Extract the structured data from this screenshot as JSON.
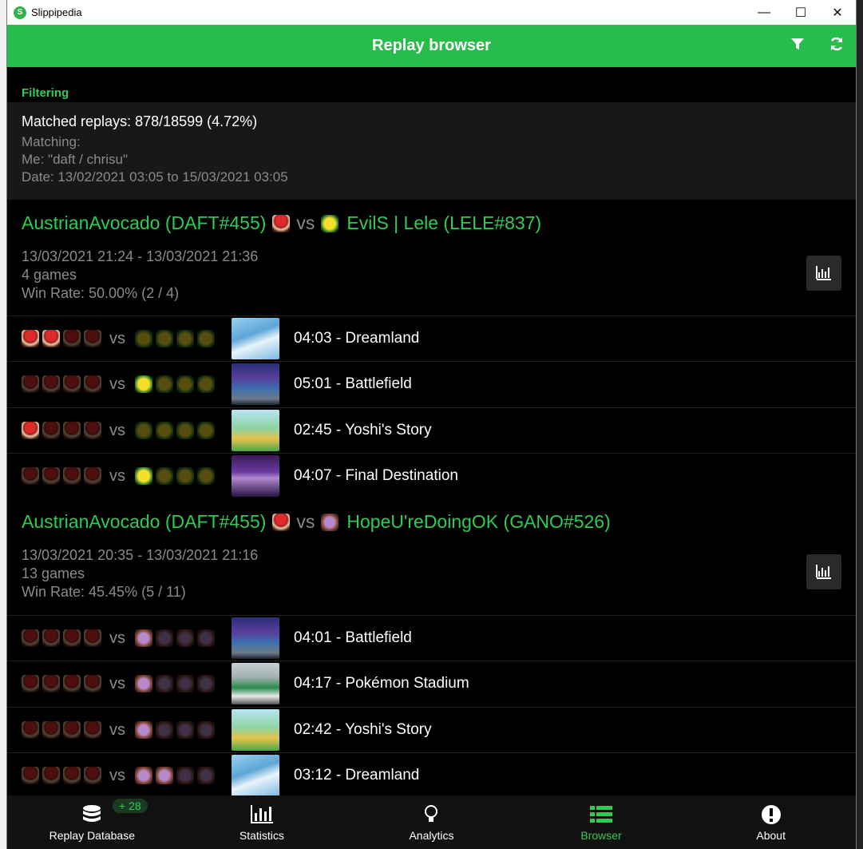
{
  "window": {
    "title": "Slippipedia",
    "minimize": "—",
    "maximize": "☐",
    "close": "✕"
  },
  "appbar": {
    "title": "Replay browser",
    "filter_icon": "filter-icon",
    "refresh_icon": "refresh-icon"
  },
  "filter": {
    "label": "Filtering",
    "matched": "Matched replays: 878/18599 (4.72%)",
    "matching": "Matching:",
    "me": "Me: \"daft / chrisu\"",
    "date": "Date: 13/02/2021 03:05 to 15/03/2021 03:05"
  },
  "groups": [
    {
      "player1": "AustrianAvocado (DAFT#455)",
      "vs": "vs",
      "player2": "EvilS | Lele (LELE#837)",
      "dates": "13/03/2021 21:24 - 13/03/2021 21:36",
      "games": "4 games",
      "winrate": "Win Rate: 50.00% (2 / 4)",
      "rows": [
        {
          "vs": "vs",
          "text": "04:03 - Dreamland"
        },
        {
          "vs": "vs",
          "text": "05:01 - Battlefield"
        },
        {
          "vs": "vs",
          "text": "02:45 - Yoshi's Story"
        },
        {
          "vs": "vs",
          "text": "04:07 - Final Destination"
        }
      ]
    },
    {
      "player1": "AustrianAvocado (DAFT#455)",
      "vs": "vs",
      "player2": "HopeU'reDoingOK (GANO#526)",
      "dates": "13/03/2021 20:35 - 13/03/2021 21:16",
      "games": "13 games",
      "winrate": "Win Rate: 45.45% (5 / 11)",
      "rows": [
        {
          "vs": "vs",
          "text": "04:01 - Battlefield"
        },
        {
          "vs": "vs",
          "text": "04:17 - Pokémon Stadium"
        },
        {
          "vs": "vs",
          "text": "02:42 - Yoshi's Story"
        },
        {
          "vs": "vs",
          "text": "03:12 - Dreamland"
        }
      ]
    }
  ],
  "nav": {
    "db": "Replay Database",
    "badge": "+ 28",
    "stats": "Statistics",
    "analytics": "Analytics",
    "browser": "Browser",
    "about": "About"
  },
  "colors": {
    "accent": "#27bd4b",
    "background": "#000000"
  }
}
